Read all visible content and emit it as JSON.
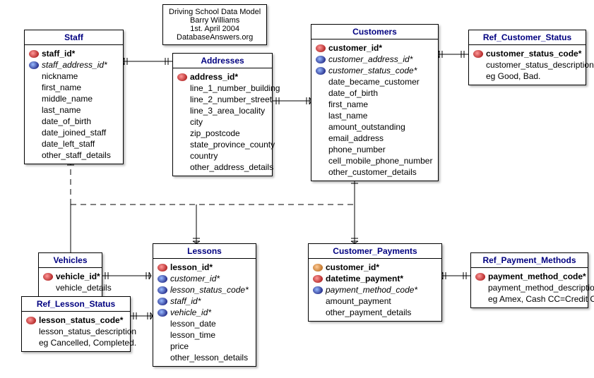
{
  "title": {
    "l1": "Driving School Data Model",
    "l2": "Barry Williams",
    "l3": "1st. April 2004",
    "l4": "DatabaseAnswers.org"
  },
  "staff": {
    "name": "Staff",
    "pk": "staff_id*",
    "fk": "staff_address_id*",
    "f": [
      "nickname",
      "first_name",
      "middle_name",
      "last_name",
      "date_of_birth",
      "date_joined_staff",
      "date_left_staff",
      "other_staff_details"
    ]
  },
  "addresses": {
    "name": "Addresses",
    "pk": "address_id*",
    "f": [
      "line_1_number_building",
      "line_2_number_street",
      "line_3_area_locality",
      "city",
      "zip_postcode",
      "state_province_county",
      "country",
      "other_address_details"
    ]
  },
  "customers": {
    "name": "Customers",
    "pk": "customer_id*",
    "fk1": "customer_address_id*",
    "fk2": "customer_status_code*",
    "f": [
      "date_became_customer",
      "date_of_birth",
      "first_name",
      "last_name",
      "amount_outstanding",
      "email_address",
      "phone_number",
      "cell_mobile_phone_number",
      "other_customer_details"
    ]
  },
  "ref_cs": {
    "name": "Ref_Customer_Status",
    "pk": "customer_status_code*",
    "f": [
      "customer_status_description",
      "eg Good, Bad."
    ]
  },
  "vehicles": {
    "name": "Vehicles",
    "pk": "vehicle_id*",
    "f": [
      "vehicle_details"
    ]
  },
  "ref_ls": {
    "name": "Ref_Lesson_Status",
    "pk": "lesson_status_code*",
    "f": [
      "lesson_status_description",
      "eg Cancelled, Completed."
    ]
  },
  "lessons": {
    "name": "Lessons",
    "pk": "lesson_id*",
    "fk": [
      "customer_id*",
      "lesson_status_code*",
      "staff_id*",
      "vehicle_id*"
    ],
    "f": [
      "lesson_date",
      "lesson_time",
      "price",
      "other_lesson_details"
    ]
  },
  "cp": {
    "name": "Customer_Payments",
    "pf": "customer_id*",
    "pk": "datetime_payment*",
    "fk": "payment_method_code*",
    "f": [
      "amount_payment",
      "other_payment_details"
    ]
  },
  "ref_pm": {
    "name": "Ref_Payment_Methods",
    "pk": "payment_method_code*",
    "f": [
      "payment_method_description",
      "eg Amex, Cash CC=Credit Card."
    ]
  }
}
